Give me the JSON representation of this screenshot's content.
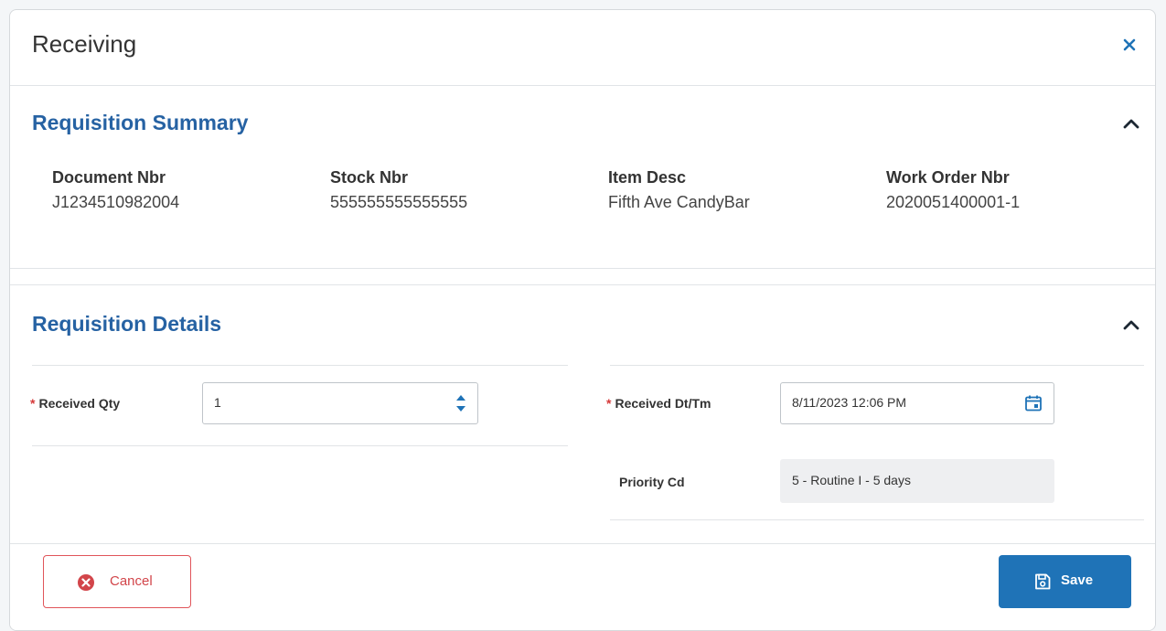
{
  "dialog": {
    "title": "Receiving"
  },
  "summary": {
    "title": "Requisition Summary",
    "fields": [
      {
        "label": "Document Nbr",
        "value": "J1234510982004"
      },
      {
        "label": "Stock Nbr",
        "value": "555555555555555"
      },
      {
        "label": "Item Desc",
        "value": "Fifth Ave CandyBar"
      },
      {
        "label": "Work Order Nbr",
        "value": "2020051400001-1"
      }
    ]
  },
  "details": {
    "title": "Requisition Details",
    "received_qty": {
      "label": "Received Qty",
      "value": "1"
    },
    "received_dttm": {
      "label": "Received Dt/Tm",
      "value": "8/11/2023 12:06 PM"
    },
    "priority_cd": {
      "label": "Priority Cd",
      "value": "5 - Routine I - 5 days"
    }
  },
  "footer": {
    "cancel_label": "Cancel",
    "save_label": "Save"
  },
  "colors": {
    "accent": "#2662a3",
    "primary_button": "#1f73b7",
    "danger": "#d63a3a"
  },
  "icons": {
    "close": "close-icon",
    "collapse": "chevron-up-icon",
    "stepper": "stepper-arrows-icon",
    "calendar": "calendar-icon",
    "cancel": "cancel-circle-icon",
    "save": "save-icon"
  }
}
